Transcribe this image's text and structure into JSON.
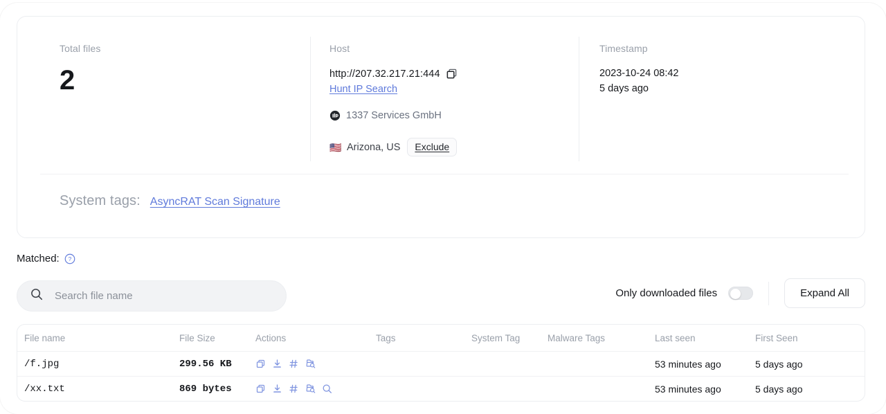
{
  "summary": {
    "total_files": {
      "label": "Total files",
      "value": "2"
    },
    "host": {
      "label": "Host",
      "url": "http://207.32.217.21:444",
      "copy_icon": "copy-icon",
      "search_link": "Hunt IP Search",
      "asn_icon": "asn-icon",
      "asn_name": "1337 Services GmbH",
      "flag": "🇺🇸",
      "location": "Arizona, US",
      "exclude_label": "Exclude"
    },
    "timestamp": {
      "label": "Timestamp",
      "absolute": "2023-10-24 08:42",
      "relative": "5 days ago"
    },
    "system_tags": {
      "label": "System tags:",
      "value": "AsyncRAT Scan Signature"
    }
  },
  "matched": {
    "label": "Matched:",
    "help_icon": "help-circle-icon"
  },
  "search": {
    "icon": "search-icon",
    "value": "",
    "placeholder": "Search file name"
  },
  "toolbar": {
    "toggle_label": "Only downloaded files",
    "toggle_on": false,
    "expand_label": "Expand All"
  },
  "table": {
    "columns": [
      "File name",
      "File Size",
      "Actions",
      "Tags",
      "System Tag",
      "Malware Tags",
      "Last seen",
      "First Seen"
    ],
    "rows": [
      {
        "file_name": "/f.jpg",
        "file_size": "299.56 KB",
        "actions": [
          "copy-icon",
          "download-icon",
          "hash-icon",
          "file-search-icon"
        ],
        "tags": "",
        "system_tag": "",
        "malware_tags": "",
        "last_seen": "53 minutes ago",
        "first_seen": "5 days ago"
      },
      {
        "file_name": "/xx.txt",
        "file_size": "869 bytes",
        "actions": [
          "copy-icon",
          "download-icon",
          "hash-icon",
          "file-search-icon",
          "search-icon"
        ],
        "tags": "",
        "system_tag": "",
        "malware_tags": "",
        "last_seen": "53 minutes ago",
        "first_seen": "5 days ago"
      }
    ]
  },
  "colors": {
    "accent_link": "#5f7adb",
    "icon_blue": "#7f94e0",
    "text_primary": "#16181c",
    "text_muted": "#9aa0aa",
    "border": "#eceef1"
  }
}
